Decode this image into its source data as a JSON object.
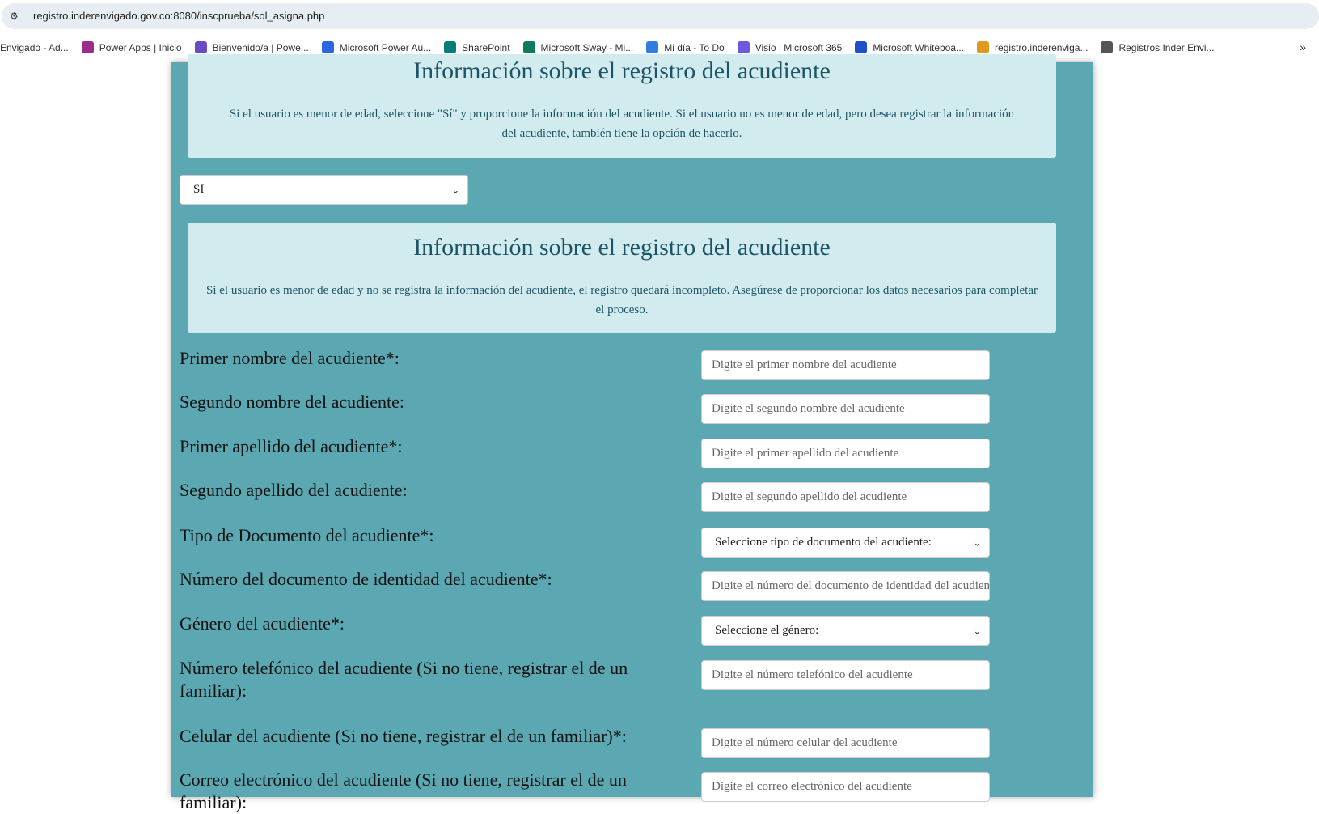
{
  "browser": {
    "url": "registro.inderenvigado.gov.co:8080/inscprueba/sol_asigna.php",
    "bookmarks": [
      {
        "label": "Envigado - Ad...",
        "color": ""
      },
      {
        "label": "Power Apps | Inicio",
        "color": "#9b2c8a"
      },
      {
        "label": "Bienvenido/a | Powe...",
        "color": "#6b4bc4"
      },
      {
        "label": "Microsoft Power Au...",
        "color": "#2a66e0"
      },
      {
        "label": "SharePoint",
        "color": "#0b7b78"
      },
      {
        "label": "Microsoft Sway - Mi...",
        "color": "#0b7b5e"
      },
      {
        "label": "Mi día - To Do",
        "color": "#2f7ee0"
      },
      {
        "label": "Visio | Microsoft 365",
        "color": "#6a5ae0"
      },
      {
        "label": "Microsoft Whiteboa...",
        "color": "#1e50c8"
      },
      {
        "label": "registro.inderenviga...",
        "color": "#e09a20"
      },
      {
        "label": "Registros Inder Envi...",
        "color": "#555555"
      }
    ],
    "more": "»"
  },
  "info1": {
    "title": "Información sobre el registro del acudiente",
    "text": "Si el usuario es menor de edad, seleccione \"Sí\" y proporcione la información del acudiente. Si el usuario no es menor de edad, pero desea registrar la información del acudiente, también tiene la opción de hacerlo."
  },
  "guardian_select": {
    "value": "SI"
  },
  "info2": {
    "title": "Información sobre el registro del acudiente",
    "text": "Si el usuario es menor de edad y no se registra la información del acudiente, el registro quedará incompleto. Asegúrese de proporcionar los datos necesarios para completar el proceso."
  },
  "fields": [
    {
      "label": "Primer nombre del acudiente*:",
      "placeholder": "Digite el primer nombre del acudiente"
    },
    {
      "label": "Segundo nombre del acudiente:",
      "placeholder": "Digite el segundo nombre del acudiente"
    },
    {
      "label": "Primer apellido del acudiente*:",
      "placeholder": "Digite el primer apellido del acudiente"
    },
    {
      "label": "Segundo apellido del acudiente:",
      "placeholder": "Digite el segundo apellido del acudiente"
    },
    {
      "label": "Tipo de Documento del acudiente*:",
      "value": "Seleccione tipo de documento del acudiente:"
    },
    {
      "label": "Número del documento de identidad del acudiente*:",
      "placeholder": "Digite el número del documento de identidad del acudiente"
    },
    {
      "label": "Género del acudiente*:",
      "value": "Seleccione el género:"
    },
    {
      "label": "Número telefónico del acudiente (Si no tiene, registrar el de un familiar):",
      "placeholder": "Digite el número telefónico del acudiente"
    },
    {
      "label": "Celular del acudiente (Si no tiene, registrar el de un familiar)*:",
      "placeholder": "Digite el número celular del acudiente"
    },
    {
      "label": "Correo electrónico del acudiente (Si no tiene, registrar el de un familiar):",
      "placeholder": "Digite el correo electrónico del acudiente"
    }
  ]
}
